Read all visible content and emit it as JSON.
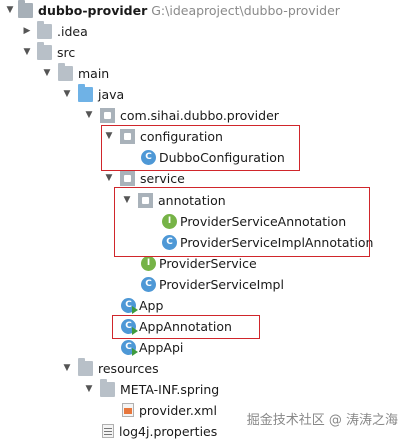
{
  "project": {
    "name": "dubbo-provider",
    "path": "G:\\ideaproject\\dubbo-provider"
  },
  "tree": {
    "idea": ".idea",
    "src": "src",
    "main": "main",
    "java": "java",
    "package": "com.sihai.dubbo.provider",
    "configuration": "configuration",
    "dubbo_configuration": "DubboConfiguration",
    "service": "service",
    "annotation": "annotation",
    "provider_service_annotation": "ProviderServiceAnnotation",
    "provider_service_impl_annotation": "ProviderServiceImplAnnotation",
    "provider_service": "ProviderService",
    "provider_service_impl": "ProviderServiceImpl",
    "app": "App",
    "app_annotation": "AppAnnotation",
    "app_api": "AppApi",
    "resources": "resources",
    "meta_inf": "META-INF.spring",
    "provider_xml": "provider.xml",
    "log4j": "log4j.properties"
  },
  "icons": {
    "class_letter": "C",
    "interface_letter": "I",
    "expanded": "▼",
    "collapsed": "▶"
  },
  "watermark": "掘金技术社区 @ 涛涛之海",
  "colors": {
    "highlight": "#d0262b",
    "class": "#4e98d6",
    "interface": "#76b347",
    "folder_blue": "#6fb2e6"
  }
}
